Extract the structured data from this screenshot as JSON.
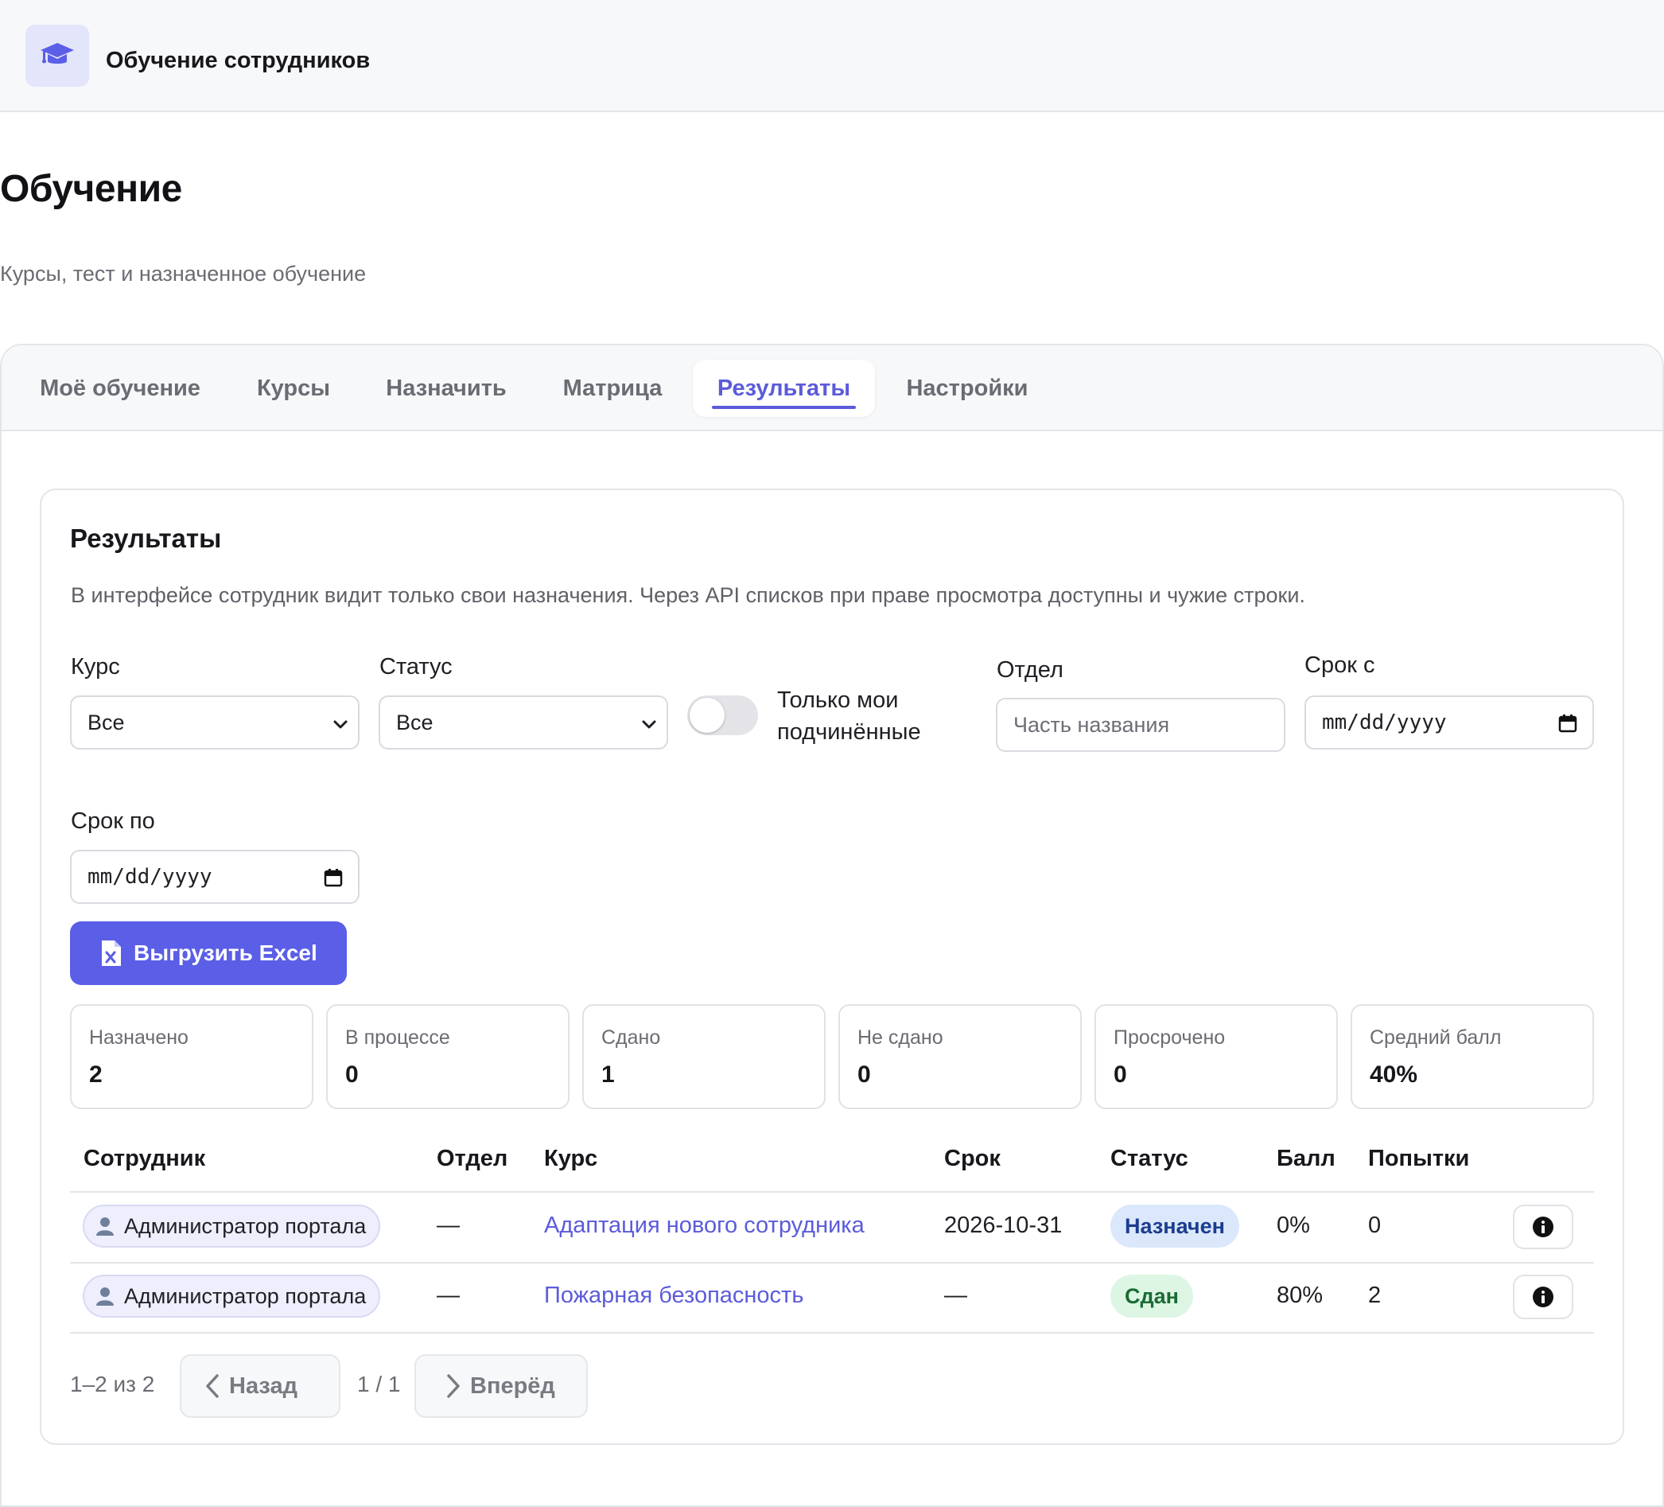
{
  "app": {
    "title": "Обучение сотрудников",
    "logo_icon": "graduation-cap-icon"
  },
  "page": {
    "title": "Обучение",
    "subtitle": "Курсы, тест и назначенное обучение"
  },
  "tabs": [
    {
      "label": "Моё обучение",
      "active": false
    },
    {
      "label": "Курсы",
      "active": false
    },
    {
      "label": "Назначить",
      "active": false
    },
    {
      "label": "Матрица",
      "active": false
    },
    {
      "label": "Результаты",
      "active": true
    },
    {
      "label": "Настройки",
      "active": false
    }
  ],
  "results": {
    "title": "Результаты",
    "description": "В интерфейсе сотрудник видит только свои назначения. Через API списков при праве просмотра доступны и чужие строки.",
    "filters": {
      "course_label": "Курс",
      "course_value": "Все",
      "status_label": "Статус",
      "status_value": "Все",
      "subordinates_label_line1": "Только мои",
      "subordinates_label_line2": "подчинённые",
      "subordinates_on": false,
      "department_label": "Отдел",
      "department_placeholder": "Часть названия",
      "due_from_label": "Срок с",
      "due_from_value": "mm/dd/yyyy",
      "due_to_label": "Срок по",
      "due_to_value": "mm/dd/yyyy"
    },
    "export_label": "Выгрузить Excel",
    "stats": [
      {
        "label": "Назначено",
        "value": "2"
      },
      {
        "label": "В процессе",
        "value": "0"
      },
      {
        "label": "Сдано",
        "value": "1"
      },
      {
        "label": "Не сдано",
        "value": "0"
      },
      {
        "label": "Просрочено",
        "value": "0"
      },
      {
        "label": "Средний балл",
        "value": "40%"
      }
    ],
    "columns": [
      "Сотрудник",
      "Отдел",
      "Курс",
      "Срок",
      "Статус",
      "Балл",
      "Попытки"
    ],
    "rows": [
      {
        "employee": "Администратор портала",
        "department": "—",
        "course": "Адаптация нового сотрудника",
        "due": "2026-10-31",
        "status": "Назначен",
        "score": "0%",
        "attempts": "0"
      },
      {
        "employee": "Администратор портала",
        "department": "—",
        "course": "Пожарная безопасность",
        "due": "—",
        "status": "Сдан",
        "score": "80%",
        "attempts": "2"
      }
    ],
    "pagination": {
      "summary": "1–2 из 2",
      "prev_label": "Назад",
      "page_info": "1 / 1",
      "next_label": "Вперёд"
    }
  },
  "colors": {
    "accent": "#5b5ee6",
    "link": "#5b5bdb",
    "assigned_badge_bg": "#dbe7fb",
    "passed_badge_bg": "#ddf6e3"
  }
}
